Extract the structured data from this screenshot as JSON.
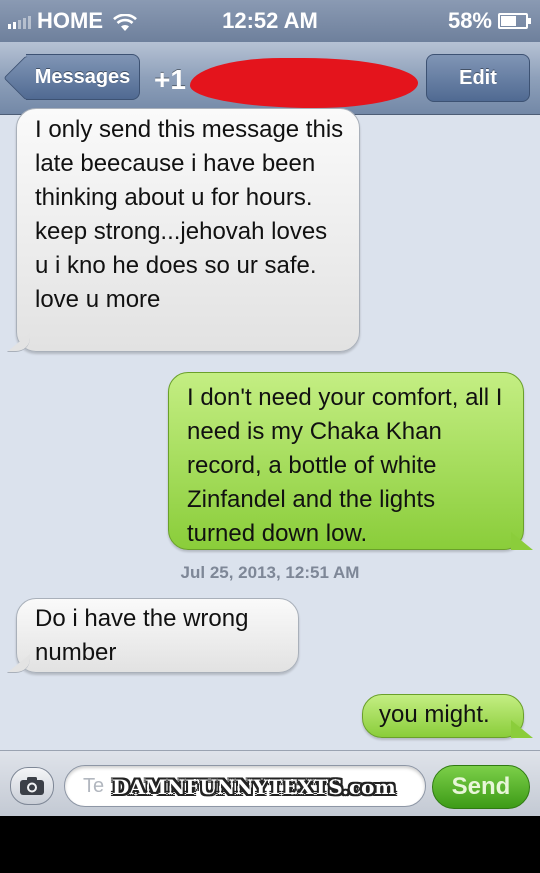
{
  "status_bar": {
    "carrier": "HOME",
    "time": "12:52 AM",
    "battery_percent": "58%",
    "battery_level": 0.58,
    "icons": [
      "signal-icon",
      "wifi-icon",
      "battery-icon"
    ]
  },
  "nav": {
    "back_label": "Messages",
    "title_prefix": "+1",
    "edit_label": "Edit"
  },
  "messages": [
    {
      "direction": "incoming",
      "text": "I only send this message this late beecause i have been thinking about u for hours. keep strong...jehovah loves u i kno he does so ur safe. love u more"
    },
    {
      "direction": "outgoing",
      "text": "I don't need your comfort, all I need is my Chaka Khan record, a bottle of white Zinfandel and the lights turned down low."
    },
    {
      "direction": "incoming",
      "text": "Do i have the wrong number"
    },
    {
      "direction": "outgoing",
      "text": "you might."
    }
  ],
  "timestamp": "Jul 25, 2013, 12:51 AM",
  "compose": {
    "placeholder": "Te",
    "send_label": "Send",
    "watermark": "DAMNFUNNYTEXTS.com"
  },
  "colors": {
    "incoming_bubble": "#e9e9e9",
    "outgoing_bubble": "#9fd84c",
    "send_button": "#52b026",
    "redaction": "#e4141c"
  }
}
